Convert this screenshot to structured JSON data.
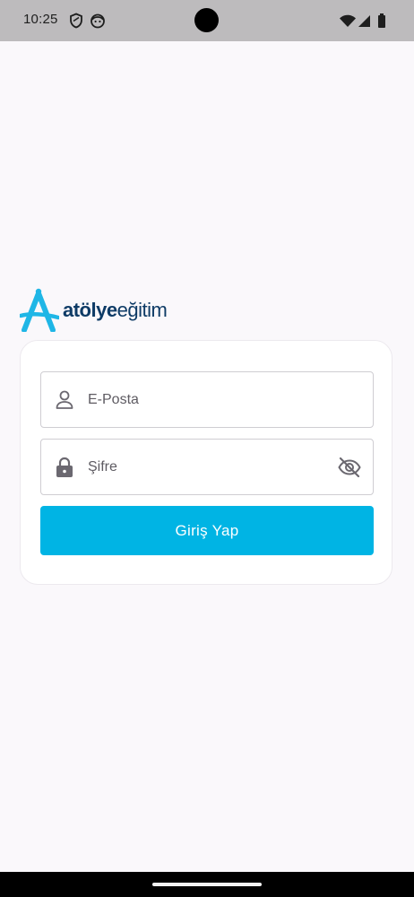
{
  "status_bar": {
    "time": "10:25",
    "left_icons": [
      "shield-icon",
      "smiley-app-icon"
    ],
    "right_icons": [
      "wifi-icon",
      "cellular-signal-icon",
      "battery-icon"
    ]
  },
  "logo": {
    "bold_text": "atölye",
    "light_text": "eğitim",
    "mark_icon": "compass-a-logo-icon",
    "colors": {
      "mark": "#1FB6E6",
      "text": "#0E3B66"
    }
  },
  "login_form": {
    "email": {
      "placeholder": "E-Posta",
      "value": "",
      "icon": "person-icon"
    },
    "password": {
      "placeholder": "Şifre",
      "value": "",
      "icon": "lock-icon",
      "toggle_icon": "eye-off-icon"
    },
    "submit_label": "Giriş Yap",
    "colors": {
      "button": "#00B4E4",
      "button_text": "#FFFFFF"
    }
  }
}
